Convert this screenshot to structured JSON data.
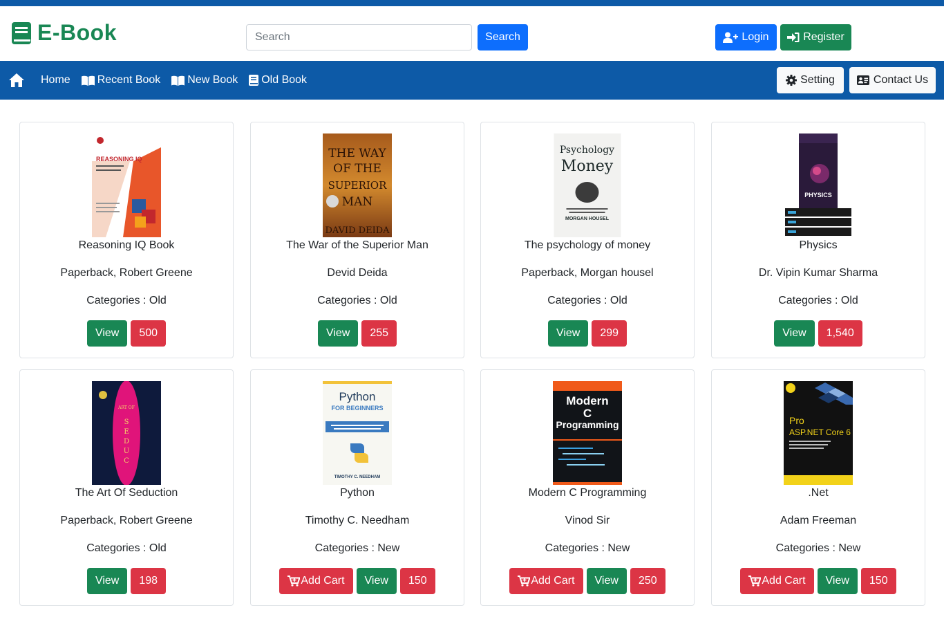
{
  "brand": {
    "name": "E-Book",
    "color": "#198754",
    "icon": "book-icon"
  },
  "search": {
    "placeholder": "Search",
    "button": "Search"
  },
  "auth": {
    "login": "Login",
    "register": "Register"
  },
  "nav": {
    "home_icon": "home-icon",
    "links": [
      {
        "label": "Home",
        "icon": ""
      },
      {
        "label": "Recent Book",
        "icon": "open-book-icon"
      },
      {
        "label": "New Book",
        "icon": "open-book-icon"
      },
      {
        "label": "Old Book",
        "icon": "book-icon"
      }
    ],
    "setting": "Setting",
    "contact": "Contact Us"
  },
  "colors": {
    "navbar": "#0d5aa7",
    "primary": "#0d6efd",
    "success": "#198754",
    "danger": "#dc3545",
    "light": "#f8f9fa"
  },
  "books": [
    {
      "title": "Reasoning IQ Book",
      "author": "Paperback, Robert Greene",
      "category": "Categories : Old",
      "view": "View",
      "price": "500",
      "cart": "",
      "cover_text": "REASONING IQ"
    },
    {
      "title": "The War of the Superior Man",
      "author": "Devid Deida",
      "category": "Categories : Old",
      "view": "View",
      "price": "255",
      "cart": "",
      "cover_text": "THE WAY OF THE SUPERIOR MAN"
    },
    {
      "title": "The psychology of money",
      "author": "Paperback, Morgan housel",
      "category": "Categories : Old",
      "view": "View",
      "price": "299",
      "cart": "",
      "cover_text": "The Psychology of Money"
    },
    {
      "title": "Physics",
      "author": "Dr. Vipin Kumar Sharma",
      "category": "Categories : Old",
      "view": "View",
      "price": "1,540",
      "cart": "",
      "cover_text": "PHYSICS"
    },
    {
      "title": "The Art Of Seduction",
      "author": "Paperback, Robert Greene",
      "category": "Categories : Old",
      "view": "View",
      "price": "198",
      "cart": "",
      "cover_text": "ART OF SEDUCTION"
    },
    {
      "title": "Python",
      "author": "Timothy C. Needham",
      "category": "Categories : New",
      "view": "View",
      "price": "150",
      "cart": "Add Cart",
      "cover_text": "Python"
    },
    {
      "title": "Modern C Programming",
      "author": "Vinod Sir",
      "category": "Categories : New",
      "view": "View",
      "price": "250",
      "cart": "Add Cart",
      "cover_text": "Modern C Programming"
    },
    {
      "title": ".Net",
      "author": "Adam Freeman",
      "category": "Categories : New",
      "view": "View",
      "price": "150",
      "cart": "Add Cart",
      "cover_text": "Pro ASP.NET Core 6"
    }
  ]
}
